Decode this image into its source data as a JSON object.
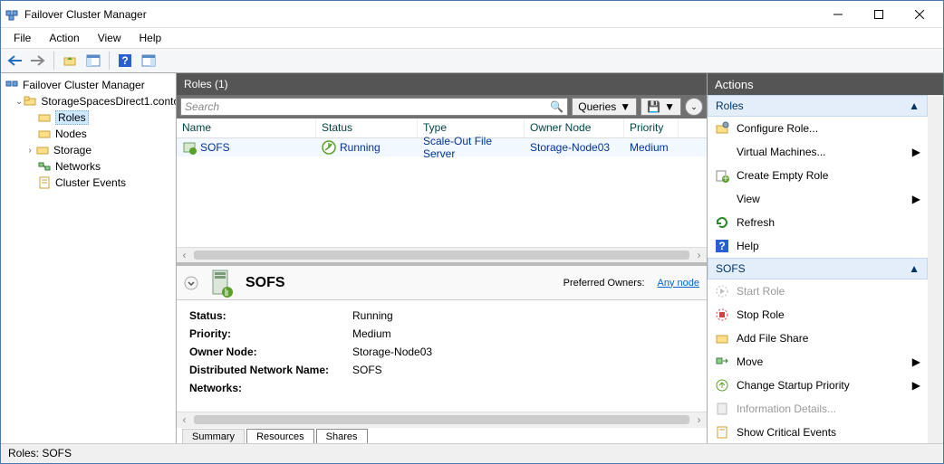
{
  "window": {
    "title": "Failover Cluster Manager"
  },
  "menu": {
    "file": "File",
    "action": "Action",
    "view": "View",
    "help": "Help"
  },
  "tree": {
    "root": "Failover Cluster Manager",
    "cluster": "StorageSpacesDirect1.conto",
    "roles": "Roles",
    "nodes": "Nodes",
    "storage": "Storage",
    "networks": "Networks",
    "events": "Cluster Events"
  },
  "center": {
    "header": "Roles (1)",
    "search_placeholder": "Search",
    "queries": "Queries",
    "columns": {
      "name": "Name",
      "status": "Status",
      "type": "Type",
      "owner": "Owner Node",
      "priority": "Priority"
    },
    "row": {
      "name": "SOFS",
      "status": "Running",
      "type": "Scale-Out File Server",
      "owner": "Storage-Node03",
      "priority": "Medium"
    }
  },
  "detail": {
    "name": "SOFS",
    "po_label": "Preferred Owners:",
    "po_link": "Any node",
    "labels": {
      "status": "Status:",
      "priority": "Priority:",
      "owner": "Owner Node:",
      "dnn": "Distributed Network Name:",
      "networks": "Networks:"
    },
    "values": {
      "status": "Running",
      "priority": "Medium",
      "owner": "Storage-Node03",
      "dnn": "SOFS",
      "networks": ""
    },
    "tabs": {
      "summary": "Summary",
      "resources": "Resources",
      "shares": "Shares"
    }
  },
  "actions": {
    "header": "Actions",
    "roles_section": "Roles",
    "configure": "Configure Role...",
    "vms": "Virtual Machines...",
    "create_empty": "Create Empty Role",
    "view": "View",
    "refresh": "Refresh",
    "help": "Help",
    "sofs_section": "SOFS",
    "start": "Start Role",
    "stop": "Stop Role",
    "add_share": "Add File Share",
    "move": "Move",
    "change_prio": "Change Startup Priority",
    "info": "Information Details...",
    "critical": "Show Critical Events"
  },
  "statusbar": "Roles:  SOFS"
}
